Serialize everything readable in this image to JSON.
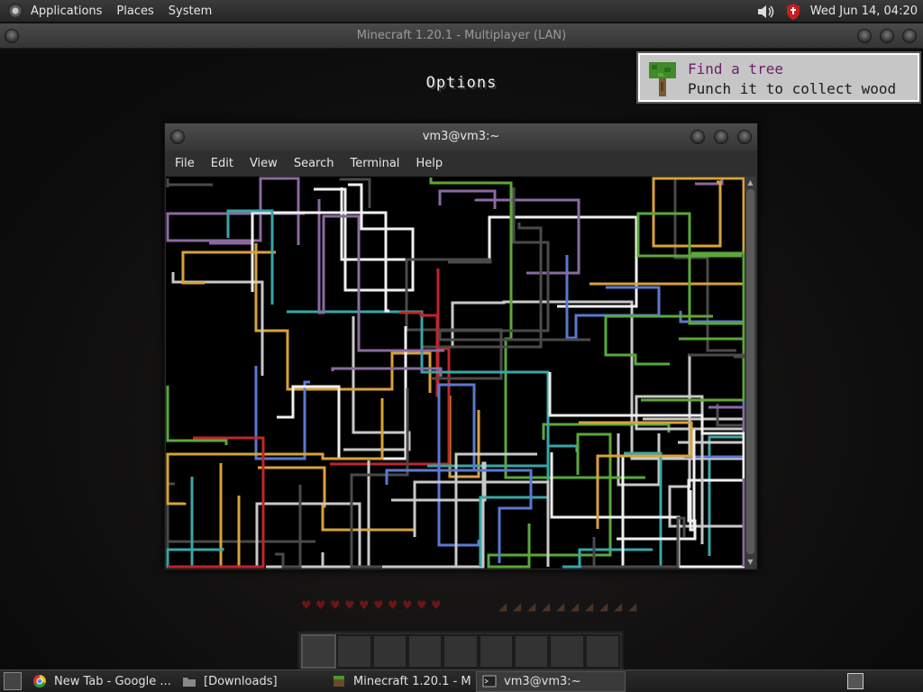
{
  "top_panel": {
    "menus": [
      "Applications",
      "Places",
      "System"
    ],
    "clock": "Wed Jun 14, 04:20",
    "icons": [
      "distro-logo-icon",
      "volume-icon",
      "shield-icon"
    ]
  },
  "minecraft_window": {
    "title": "Minecraft 1.20.1 - Multiplayer (LAN)",
    "screen_title": "Options",
    "toast": {
      "title": "Find a tree",
      "description": "Punch it to collect wood"
    },
    "hearts": 10,
    "food": 10,
    "hotbar_slots": 9
  },
  "terminal": {
    "title": "vm3@vm3:~",
    "menu": [
      "File",
      "Edit",
      "View",
      "Search",
      "Terminal",
      "Help"
    ],
    "pipe_colors": [
      "#c8c8c8",
      "#3aa6a6",
      "#d8a23a",
      "#c0262a",
      "#5a7ad0",
      "#5aa83a",
      "#8a6aa0",
      "#4a4a4a",
      "#f0f0f0"
    ]
  },
  "taskbar": {
    "tasks": [
      {
        "label": "New Tab - Google ...",
        "icon": "chrome-icon"
      },
      {
        "label": "[Downloads]",
        "icon": "folder-icon"
      },
      {
        "label": "Minecraft 1.20.1 - M...",
        "icon": "minecraft-icon"
      },
      {
        "label": "vm3@vm3:~",
        "icon": "terminal-icon"
      }
    ]
  }
}
